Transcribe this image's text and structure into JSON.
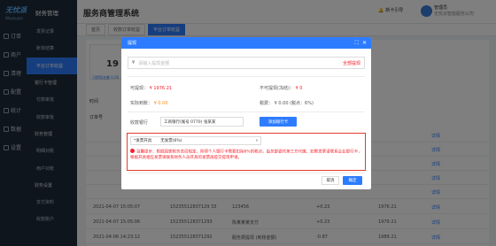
{
  "app": {
    "logo": "无忧派",
    "logo_sub": "Wuyoupai",
    "sidebar_title": "财务管理",
    "page_title": "服务商管理系统"
  },
  "nav": [
    {
      "label": "订单"
    },
    {
      "label": "商户"
    },
    {
      "label": "清理"
    },
    {
      "label": "配置"
    },
    {
      "label": "统计"
    },
    {
      "label": "数据"
    },
    {
      "label": "设置"
    }
  ],
  "subnav": [
    {
      "label": "发票记录",
      "type": "item"
    },
    {
      "label": "账单结算",
      "type": "item"
    },
    {
      "label": "平台订单收益",
      "type": "active"
    },
    {
      "label": "银行卡管理",
      "type": "head"
    },
    {
      "label": "付款审批",
      "type": "item"
    },
    {
      "label": "收款审批",
      "type": "item"
    },
    {
      "label": "财务管理",
      "type": "head"
    },
    {
      "label": "明细对账",
      "type": "item"
    },
    {
      "label": "用户对账",
      "type": "item"
    },
    {
      "label": "财务设置",
      "type": "head"
    },
    {
      "label": "支付资料",
      "type": "item"
    },
    {
      "label": "收款账户",
      "type": "item"
    }
  ],
  "header": {
    "message": "新卡引导",
    "user_name": "管理员",
    "user_company": "无忧派智能服务公司"
  },
  "tabs": [
    {
      "label": "首页"
    },
    {
      "label": "收款订单收益"
    },
    {
      "label": "平台订单收益"
    }
  ],
  "main": {
    "card_value": "19",
    "card_link": "可提现金额 0.00",
    "label_time": "时间",
    "label_order": "订单号",
    "rows": [
      {
        "time": "2021-04-07 15:05:07",
        "order": "15235512837129 33",
        "id": "123456",
        "amt": "+0.23",
        "bal": "1976.21",
        "op": "详情"
      },
      {
        "time": "2021-04-07 15:05:06",
        "order": "152355128371293",
        "id": "陈某某某支付",
        "amt": "+0.23",
        "bal": "1979.21",
        "op": "详情"
      },
      {
        "time": "2021-04-06 14:23:12",
        "order": "152355128371292",
        "id": "服务费提现 (到账金额)",
        "amt": "-0.87",
        "bal": "1989.21",
        "op": "详情"
      }
    ],
    "detail_labels": [
      "详情",
      "详情",
      "详情",
      "详情",
      "详情"
    ]
  },
  "modal": {
    "title": "提现",
    "currency": "¥",
    "amount_placeholder": "请输入提现金额",
    "withdraw_all": "全部提现",
    "withdrawable_label": "可提现：",
    "withdrawable_value": "¥ 1976.21",
    "frozen_label": "不可提现(冻结)：",
    "frozen_value": "¥ 0",
    "actual_label": "实际到账：",
    "actual_value": "¥ 0.00",
    "tax_label": "税费：",
    "tax_value": "¥ 0.00 (税点：6%)",
    "bank_label": "收款银行",
    "bank_value": "工商银行(尾号 0770) 张某某",
    "bank_button": "添加银行卡",
    "invoice_label": "*发票开具",
    "invoice_value": "无发票(6%)",
    "notice": "温馨提示：根据国家税务总局规定，所得个人银行卡需要扣除6%的税点，由总部委托第三方代缴。如需发票请联系企业银行卡，根据开具相应发票请联系财务人员开具的发票再提交提现申请。",
    "cancel": "取消",
    "confirm": "确定"
  }
}
